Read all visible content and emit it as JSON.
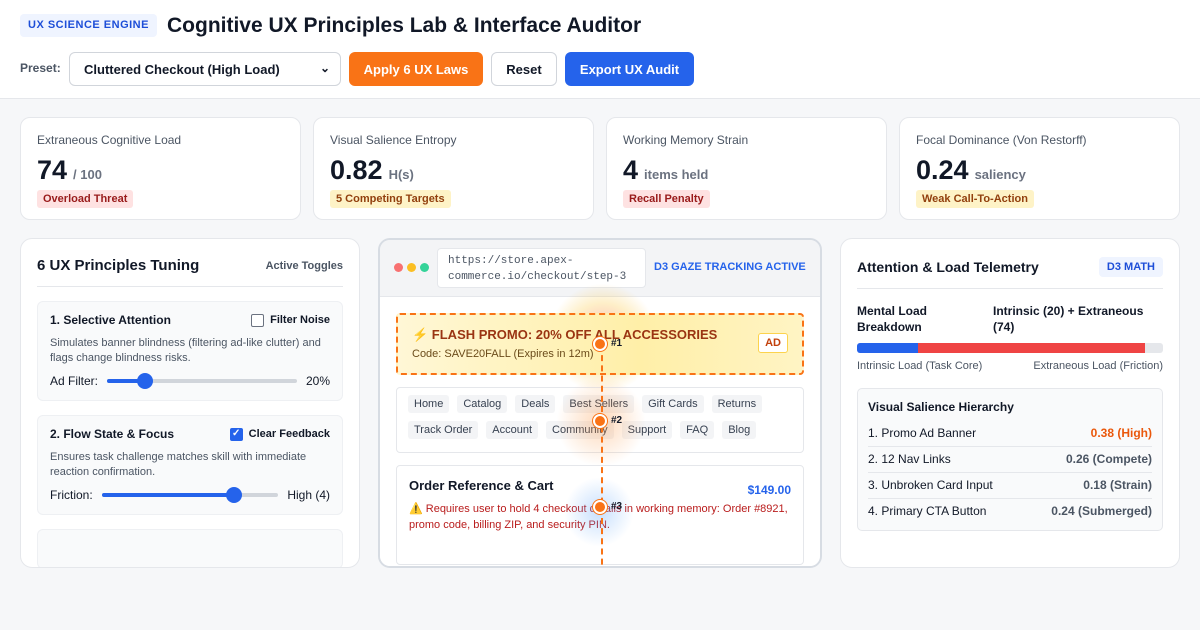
{
  "header": {
    "engine_badge": "UX SCIENCE ENGINE",
    "title": "Cognitive UX Principles Lab & Interface Auditor",
    "preset_label": "Preset:",
    "preset_value": "Cluttered Checkout (High Load)",
    "apply_label": "Apply 6 UX Laws",
    "reset_label": "Reset",
    "export_label": "Export UX Audit"
  },
  "metrics": [
    {
      "label": "Extraneous Cognitive Load",
      "value": "74",
      "unit": "/ 100",
      "badge": "Overload Threat",
      "badge_tone": "red"
    },
    {
      "label": "Visual Salience Entropy",
      "value": "0.82",
      "unit": "H(s)",
      "badge": "5 Competing Targets",
      "badge_tone": "yellow"
    },
    {
      "label": "Working Memory Strain",
      "value": "4",
      "unit": "items held",
      "badge": "Recall Penalty",
      "badge_tone": "red"
    },
    {
      "label": "Focal Dominance (Von Restorff)",
      "value": "0.24",
      "unit": "saliency",
      "badge": "Weak Call-To-Action",
      "badge_tone": "yellow"
    }
  ],
  "tuning": {
    "title": "6 UX Principles Tuning",
    "subtitle": "Active Toggles",
    "principles": [
      {
        "title": "1. Selective Attention",
        "toggle_label": "Filter Noise",
        "checked": false,
        "desc": "Simulates banner blindness (filtering ad-like clutter) and flags change blindness risks.",
        "slider_label": "Ad Filter:",
        "slider_value": "20%",
        "slider_fraction": 0.2
      },
      {
        "title": "2. Flow State & Focus",
        "toggle_label": "Clear Feedback",
        "checked": true,
        "desc": "Ensures task challenge matches skill with immediate reaction confirmation.",
        "slider_label": "Friction:",
        "slider_value": "High (4)",
        "slider_fraction": 0.75
      }
    ]
  },
  "preview": {
    "url": "https://store.apex-commerce.io/checkout/step-3",
    "gaze_label": "D3 GAZE TRACKING ACTIVE",
    "promo_title": "⚡ FLASH PROMO: 20% OFF ALL ACCESSORIES",
    "promo_code": "Code: SAVE20FALL (Expires in 12m)",
    "ad_badge": "AD",
    "nav_links": [
      "Home",
      "Catalog",
      "Deals",
      "Best Sellers",
      "Gift Cards",
      "Returns",
      "Track Order",
      "Account",
      "Community",
      "Support",
      "FAQ",
      "Blog"
    ],
    "cart_title": "Order Reference & Cart",
    "cart_price": "$149.00",
    "cart_warning": "⚠️ Requires user to hold 4 checkout details in working memory: Order #8921, promo code, billing ZIP, and security PIN.",
    "gaze_points": [
      "#1",
      "#2",
      "#3"
    ]
  },
  "telemetry": {
    "title": "Attention & Load Telemetry",
    "badge": "D3 MATH",
    "breakdown_label": "Mental Load Breakdown",
    "breakdown_value": "Intrinsic (20) + Extraneous (74)",
    "intrinsic": 20,
    "extraneous": 74,
    "legend_intrinsic": "Intrinsic Load (Task Core)",
    "legend_extraneous": "Extraneous Load (Friction)",
    "hierarchy_title": "Visual Salience Hierarchy",
    "hierarchy": [
      {
        "name": "1. Promo Ad Banner",
        "value": "0.38 (High)",
        "hot": true
      },
      {
        "name": "2. 12 Nav Links",
        "value": "0.26 (Compete)",
        "hot": false
      },
      {
        "name": "3. Unbroken Card Input",
        "value": "0.18 (Strain)",
        "hot": false
      },
      {
        "name": "4. Primary CTA Button",
        "value": "0.24 (Submerged)",
        "hot": false
      }
    ]
  },
  "colors": {
    "accent_blue": "#2563eb",
    "accent_orange": "#f97316",
    "danger_red": "#ef4444"
  }
}
